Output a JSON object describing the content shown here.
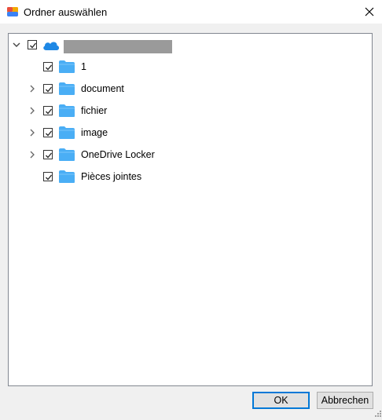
{
  "window": {
    "title": "Ordner auswählen"
  },
  "tree": {
    "root": {
      "label": "",
      "redacted": true,
      "expanded": true,
      "checked": true,
      "icon": "cloud-icon"
    },
    "children": [
      {
        "label": "1",
        "has_children": false,
        "checked": true
      },
      {
        "label": "document",
        "has_children": true,
        "checked": true
      },
      {
        "label": "fichier",
        "has_children": true,
        "checked": true
      },
      {
        "label": "image",
        "has_children": true,
        "checked": true
      },
      {
        "label": "OneDrive Locker",
        "has_children": true,
        "checked": true
      },
      {
        "label": "Pièces jointes",
        "has_children": false,
        "checked": true
      }
    ]
  },
  "buttons": {
    "ok": "OK",
    "cancel": "Abbrechen"
  },
  "colors": {
    "folder": "#4aaef5",
    "cloud": "#1e88e5",
    "focus_border": "#0078d7"
  }
}
